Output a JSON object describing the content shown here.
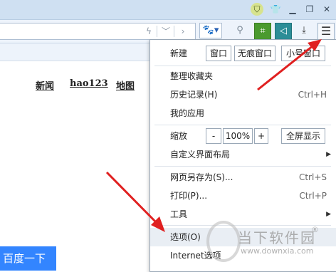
{
  "titlebar": {
    "skin_icon": "shirt-icon",
    "buttons": [
      "⛉",
      "♠",
      "▼",
      "🗗",
      "✕"
    ]
  },
  "toolbar": {
    "paw_icon": "baidu-paw-icon",
    "menu_icon": "hamburger-menu-icon"
  },
  "page": {
    "links": [
      "新闻",
      "hao123",
      "地图"
    ],
    "search_button": "百度一下"
  },
  "menu": {
    "new_label": "新建",
    "new_window": "窗口",
    "new_private": "无痕窗口",
    "new_small": "小号窗口",
    "organize_favorites": "整理收藏夹",
    "history": "历史记录(H)",
    "history_shortcut": "Ctrl+H",
    "my_apps": "我的应用",
    "zoom_label": "缩放",
    "zoom_minus": "-",
    "zoom_value": "100%",
    "zoom_plus": "+",
    "fullscreen": "全屏显示",
    "customize_layout": "自定义界面布局",
    "save_as": "网页另存为(S)...",
    "save_as_shortcut": "Ctrl+S",
    "print": "打印(P)...",
    "print_shortcut": "Ctrl+P",
    "tools": "工具",
    "options": "选项(O)",
    "internet_options": "Internet选项"
  },
  "watermark": {
    "title": "当下软件园",
    "reg": "®",
    "url": "www.downxia.com"
  },
  "colors": {
    "accent_blue": "#3385ff",
    "arrow_red": "#e02020"
  }
}
